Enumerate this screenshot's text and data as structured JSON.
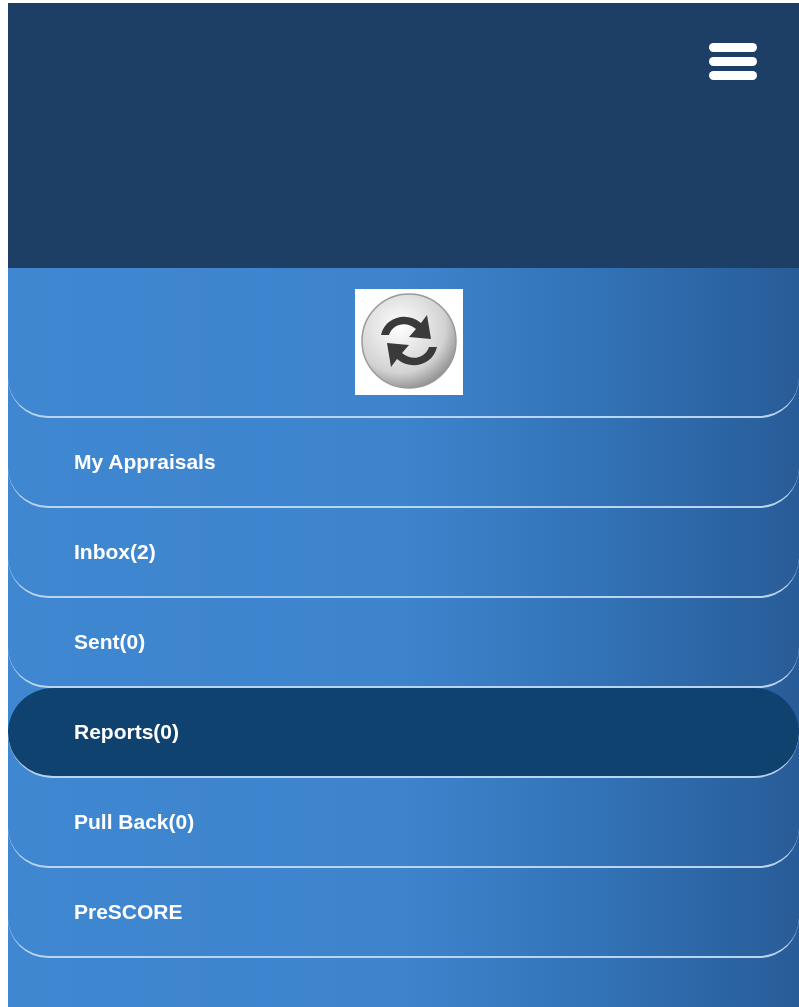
{
  "menu": {
    "items": [
      {
        "label": "My Appraisals",
        "selected": false
      },
      {
        "label": "Inbox(2)",
        "selected": false
      },
      {
        "label": "Sent(0)",
        "selected": false
      },
      {
        "label": "Reports(0)",
        "selected": true
      },
      {
        "label": "Pull Back(0)",
        "selected": false
      },
      {
        "label": "PreSCORE",
        "selected": false
      }
    ]
  }
}
